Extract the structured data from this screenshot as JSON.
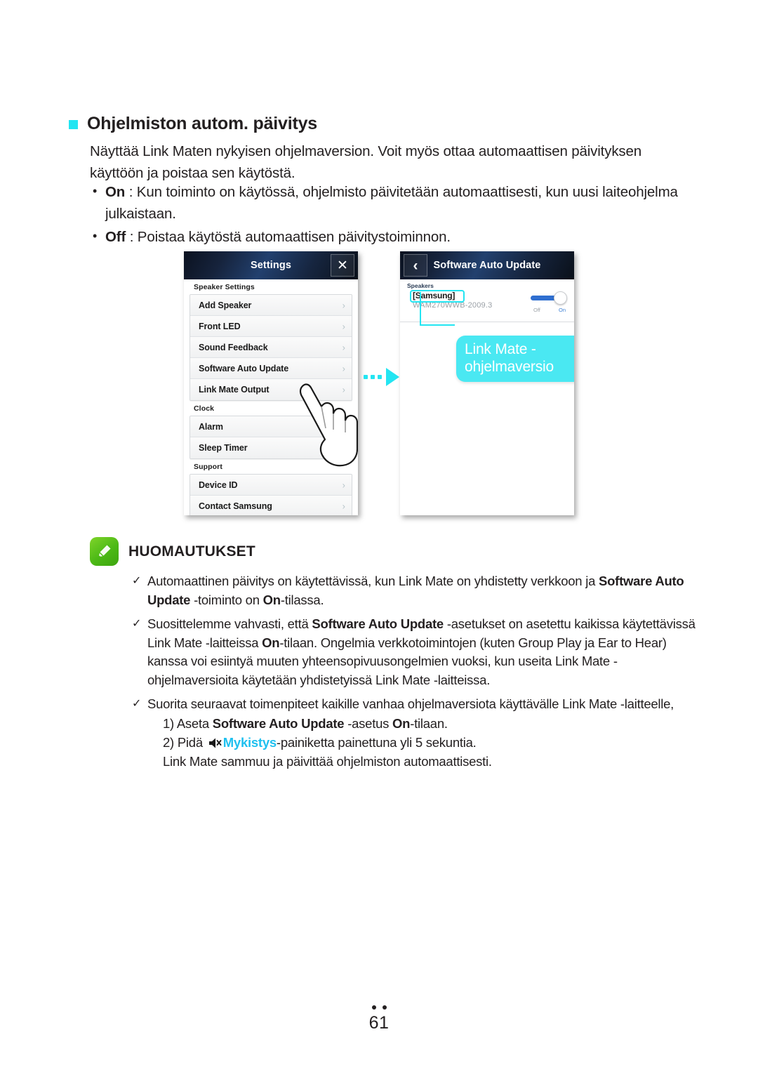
{
  "section": {
    "heading": "Ohjelmiston autom. päivitys",
    "bullet_color": "#23e5f2",
    "intro": "Näyttää Link Maten nykyisen ohjelmaversion. Voit myös ottaa automaattisen päivityksen käyttöön ja poistaa sen käytöstä.",
    "options": [
      {
        "term": "On",
        "text": " : Kun toiminto on käytössä, ohjelmisto päivitetään automaattisesti, kun uusi laiteohjelma julkaistaan."
      },
      {
        "term": "Off",
        "text": " : Poistaa käytöstä automaattisen päivitystoiminnon."
      }
    ]
  },
  "settings_screen": {
    "title": "Settings",
    "close_label": "✕",
    "groups": [
      {
        "label": "Speaker Settings",
        "rows": [
          "Add Speaker",
          "Front LED",
          "Sound Feedback",
          "Software Auto Update",
          "Link Mate Output"
        ]
      },
      {
        "label": "Clock",
        "rows": [
          "Alarm",
          "Sleep Timer"
        ]
      },
      {
        "label": "Support",
        "rows": [
          "Device ID",
          "Contact Samsung"
        ]
      }
    ],
    "chevron": "›"
  },
  "update_screen": {
    "title": "Software Auto Update",
    "back_label": "‹",
    "group_label": "Speakers",
    "speaker_name": "[Samsung]",
    "speaker_version": "WAM270WWB-2009.3",
    "toggle_off_label": "Off",
    "toggle_on_label": "On",
    "toggle_state": "On",
    "callout_text": "Link Mate -ohjelmaversio",
    "callout_color": "#4ae8f2"
  },
  "notes": {
    "title": "HUOMAUTUKSET",
    "icon_color": "#4cb916",
    "items": [
      {
        "parts": [
          {
            "t": "Automaattinen päivitys on käytettävissä, kun Link Mate on yhdistetty verkkoon ja ",
            "b": false
          },
          {
            "t": "Software Auto Update",
            "b": true
          },
          {
            "t": " -toiminto on ",
            "b": false
          },
          {
            "t": "On",
            "b": true
          },
          {
            "t": "-tilassa.",
            "b": false
          }
        ]
      },
      {
        "parts": [
          {
            "t": "Suosittelemme vahvasti, että ",
            "b": false
          },
          {
            "t": "Software Auto Update",
            "b": true
          },
          {
            "t": " -asetukset on asetettu kaikissa käytettävissä Link Mate -laitteissa ",
            "b": false
          },
          {
            "t": "On",
            "b": true
          },
          {
            "t": "-tilaan. Ongelmia verkkotoimintojen (kuten Group Play ja Ear to Hear) kanssa voi esiintyä muuten yhteensopivuusongelmien vuoksi, kun useita Link Mate -ohjelmaversioita käytetään yhdistetyissä Link Mate -laitteissa.",
            "b": false
          }
        ]
      },
      {
        "parts": [
          {
            "t": "Suorita seuraavat toimenpiteet kaikille vanhaa ohjelmaversiota käyttävälle Link Mate -laitteelle,",
            "b": false
          }
        ]
      }
    ],
    "steps": {
      "step1_prefix": "1) Aseta ",
      "step1_bold": "Software Auto Update",
      "step1_mid": " -asetus ",
      "step1_bold2": "On",
      "step1_suffix": "-tilaan.",
      "step2_prefix": "2) Pidä ",
      "step2_cyan": "Mykistys",
      "step2_suffix": "-painiketta painettuna yli 5 sekuntia.",
      "step3": "Link Mate sammuu ja päivittää ohjelmiston automaattisesti."
    },
    "tick": "✓"
  },
  "footer": {
    "page_number": "61"
  }
}
